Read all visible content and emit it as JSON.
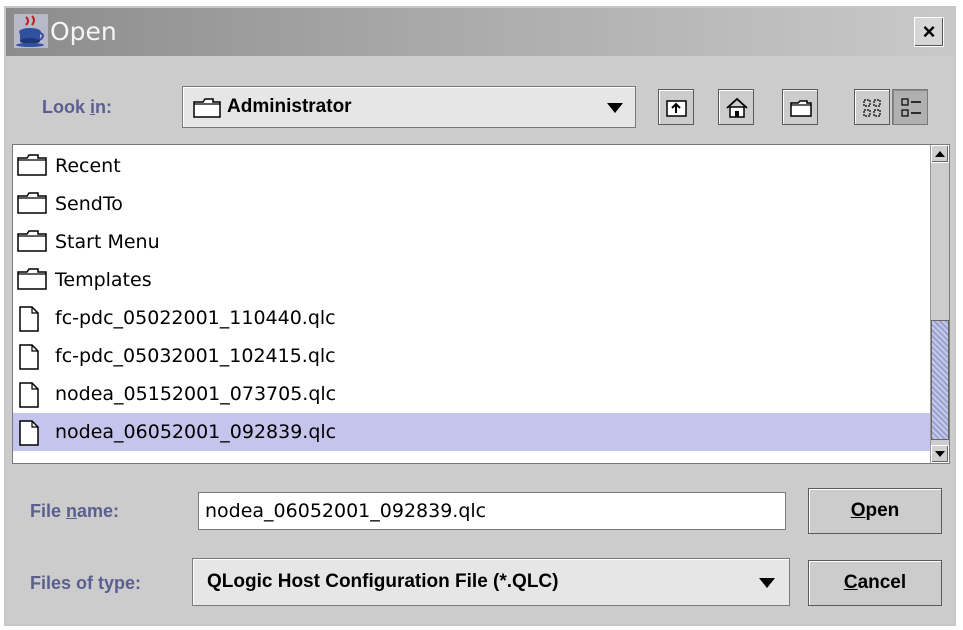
{
  "window": {
    "title": "Open",
    "close_glyph": "×"
  },
  "look_in": {
    "label_pre": "Look ",
    "label_mnemonic": "i",
    "label_post": "n:",
    "selected": "Administrator",
    "icon": "folder-icon"
  },
  "toolbar": {
    "icons": [
      "up-one-level-icon",
      "home-icon",
      "new-folder-icon",
      "list-view-icon",
      "details-view-icon"
    ]
  },
  "files": [
    {
      "name": "Recent",
      "kind": "folder",
      "selected": false
    },
    {
      "name": "SendTo",
      "kind": "folder",
      "selected": false
    },
    {
      "name": "Start Menu",
      "kind": "folder",
      "selected": false
    },
    {
      "name": "Templates",
      "kind": "folder",
      "selected": false
    },
    {
      "name": "fc-pdc_05022001_110440.qlc",
      "kind": "file",
      "selected": false
    },
    {
      "name": "fc-pdc_05032001_102415.qlc",
      "kind": "file",
      "selected": false
    },
    {
      "name": "nodea_05152001_073705.qlc",
      "kind": "file",
      "selected": false
    },
    {
      "name": "nodea_06052001_092839.qlc",
      "kind": "file",
      "selected": true
    }
  ],
  "file_name": {
    "label_pre": "File ",
    "label_mnemonic": "n",
    "label_post": "ame:",
    "value": "nodea_06052001_092839.qlc"
  },
  "file_type": {
    "label": "Files of type:",
    "selected": "QLogic Host Configuration File (*.QLC)"
  },
  "buttons": {
    "open_mnemonic": "O",
    "open_rest": "pen",
    "cancel_mnemonic": "C",
    "cancel_rest": "ancel"
  },
  "colors": {
    "selection": "#c4c4ec",
    "label": "#5a5f8f",
    "panel": "#cccccc"
  }
}
